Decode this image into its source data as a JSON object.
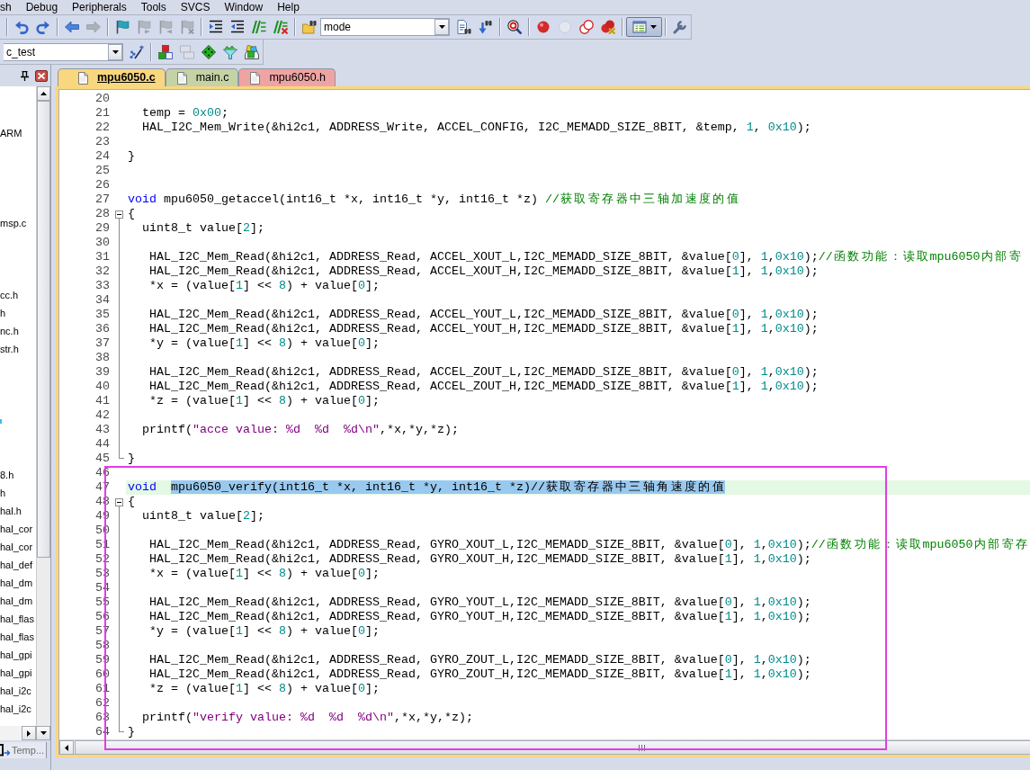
{
  "menu_bar": {
    "items": [
      "sh",
      "Debug",
      "Peripherals",
      "Tools",
      "SVCS",
      "Window",
      "Help"
    ]
  },
  "toolbars": [
    {
      "items": [
        {
          "kind": "separator"
        },
        {
          "kind": "button",
          "disabled": false,
          "on": false
        },
        {
          "kind": "button",
          "disabled": false,
          "on": false
        },
        {
          "kind": "separator"
        },
        {
          "kind": "button",
          "disabled": false,
          "on": false
        },
        {
          "kind": "button",
          "disabled": true,
          "on": false
        },
        {
          "kind": "separator"
        },
        {
          "kind": "button",
          "disabled": false,
          "on": false
        },
        {
          "kind": "button",
          "disabled": true,
          "on": false
        },
        {
          "kind": "button",
          "disabled": true,
          "on": false
        },
        {
          "kind": "button",
          "disabled": true,
          "on": false
        },
        {
          "kind": "separator"
        },
        {
          "kind": "button",
          "disabled": false,
          "on": false
        },
        {
          "kind": "button",
          "disabled": false,
          "on": false
        },
        {
          "kind": "button",
          "disabled": false,
          "on": false
        },
        {
          "kind": "button",
          "disabled": false,
          "on": false
        },
        {
          "kind": "separator"
        },
        {
          "kind": "button",
          "disabled": false,
          "on": false
        },
        {
          "kind": "combo",
          "value": "mode"
        },
        {
          "kind": "button",
          "disabled": false,
          "on": false
        },
        {
          "kind": "button",
          "disabled": false,
          "on": false
        },
        {
          "kind": "separator"
        },
        {
          "kind": "button",
          "disabled": false,
          "on": false
        },
        {
          "kind": "separator"
        },
        {
          "kind": "button",
          "disabled": false,
          "on": false
        },
        {
          "kind": "button",
          "disabled": true,
          "on": false
        },
        {
          "kind": "button",
          "disabled": false,
          "on": false
        },
        {
          "kind": "button",
          "disabled": false,
          "on": false
        },
        {
          "kind": "separator"
        },
        {
          "kind": "split_button",
          "disabled": false,
          "on": true
        },
        {
          "kind": "separator"
        },
        {
          "kind": "button",
          "disabled": false,
          "on": false
        }
      ]
    },
    {
      "items": [
        {
          "kind": "combo",
          "value": "c_test"
        },
        {
          "kind": "button",
          "disabled": false,
          "on": false
        },
        {
          "kind": "separator"
        },
        {
          "kind": "button",
          "disabled": false,
          "on": false
        },
        {
          "kind": "button",
          "disabled": true,
          "on": false
        },
        {
          "kind": "button",
          "disabled": false,
          "on": false
        },
        {
          "kind": "button",
          "disabled": false,
          "on": false
        },
        {
          "kind": "button",
          "disabled": false,
          "on": false
        }
      ]
    }
  ],
  "project_panel": {
    "items": [
      {
        "label": "ARM",
        "selected": false
      },
      {
        "label": "msp.c",
        "selected": false
      },
      {
        "label": "cc.h",
        "selected": false
      },
      {
        "label": "h",
        "selected": false
      },
      {
        "label": "nc.h",
        "selected": false
      },
      {
        "label": "str.h",
        "selected": false
      },
      {
        "label": "8.h",
        "selected": false
      },
      {
        "label": "h",
        "selected": false
      },
      {
        "label": "hal.h",
        "selected": false
      },
      {
        "label": "hal_cor",
        "selected": false
      },
      {
        "label": "hal_cor",
        "selected": false
      },
      {
        "label": "hal_def",
        "selected": false
      },
      {
        "label": "hal_dm",
        "selected": false
      },
      {
        "label": "hal_dm",
        "selected": false
      },
      {
        "label": "hal_flas",
        "selected": false
      },
      {
        "label": "hal_flas",
        "selected": false
      },
      {
        "label": "hal_gpi",
        "selected": false
      },
      {
        "label": "hal_gpi",
        "selected": false
      },
      {
        "label": "hal_i2c",
        "selected": false
      },
      {
        "label": "hal_i2c",
        "selected": false
      }
    ],
    "tabs": [
      {
        "label": "Temp...",
        "selected": false
      }
    ]
  },
  "editor": {
    "tabs": [
      {
        "label": "mpu6050.c",
        "selected": true,
        "color": "#f9d77f"
      },
      {
        "label": "main.c",
        "selected": false,
        "color": "#c5d2a5"
      },
      {
        "label": "mpu6050.h",
        "selected": false,
        "color": "#efa4a4"
      }
    ],
    "lines": [
      {
        "number": "20",
        "current": false
      },
      {
        "number": "21",
        "current": false,
        "segments": [
          {
            "kind": "code",
            "text": "  temp = 0x00;"
          }
        ]
      },
      {
        "number": "22",
        "current": false,
        "segments": [
          {
            "kind": "code",
            "text": "  HAL_I2C_Mem_Write(&hi2c1, ADDRESS_Write, ACCEL_CONFIG, I2C_MEMADD_SIZE_8BIT, &temp, 1, 0x10);"
          }
        ]
      },
      {
        "number": "23",
        "current": false
      },
      {
        "number": "24",
        "current": false,
        "segments": [
          {
            "kind": "code",
            "text": "}"
          }
        ]
      },
      {
        "number": "25",
        "current": false
      },
      {
        "number": "26",
        "current": false
      },
      {
        "number": "27",
        "current": false,
        "segments": [
          {
            "kind": "keyword",
            "text": "void"
          },
          {
            "kind": "code",
            "text": " mpu6050_getaccel(int16_t *x, int16_t *y, int16_t *z) "
          },
          {
            "kind": "comment",
            "text": "//获取寄存器中三轴加速度的值"
          }
        ]
      },
      {
        "number": "28",
        "current": false,
        "expanded": true,
        "segments": [
          {
            "kind": "code",
            "text": "{"
          }
        ],
        "children": [
          {
            "number": "29",
            "current": false,
            "segments": [
              {
                "kind": "code",
                "text": "  uint8_t value[2];"
              }
            ]
          },
          {
            "number": "30",
            "current": false
          },
          {
            "number": "31",
            "current": false,
            "segments": [
              {
                "kind": "code",
                "text": "   HAL_I2C_Mem_Read(&hi2c1, ADDRESS_Read, ACCEL_XOUT_L,I2C_MEMADD_SIZE_8BIT, &value[0], 1,0x10);"
              },
              {
                "kind": "comment",
                "text": "//函数功能：读取mpu6050内部寄"
              }
            ]
          },
          {
            "number": "32",
            "current": false,
            "segments": [
              {
                "kind": "code",
                "text": "   HAL_I2C_Mem_Read(&hi2c1, ADDRESS_Read, ACCEL_XOUT_H,I2C_MEMADD_SIZE_8BIT, &value[1], 1,0x10);"
              }
            ]
          },
          {
            "number": "33",
            "current": false,
            "segments": [
              {
                "kind": "code",
                "text": "   *x = (value[1] << 8) + value[0];"
              }
            ]
          },
          {
            "number": "34",
            "current": false
          },
          {
            "number": "35",
            "current": false,
            "segments": [
              {
                "kind": "code",
                "text": "   HAL_I2C_Mem_Read(&hi2c1, ADDRESS_Read, ACCEL_YOUT_L,I2C_MEMADD_SIZE_8BIT, &value[0], 1,0x10);"
              }
            ]
          },
          {
            "number": "36",
            "current": false,
            "segments": [
              {
                "kind": "code",
                "text": "   HAL_I2C_Mem_Read(&hi2c1, ADDRESS_Read, ACCEL_YOUT_H,I2C_MEMADD_SIZE_8BIT, &value[1], 1,0x10);"
              }
            ]
          },
          {
            "number": "37",
            "current": false,
            "segments": [
              {
                "kind": "code",
                "text": "   *y = (value[1] << 8) + value[0];"
              }
            ]
          },
          {
            "number": "38",
            "current": false
          },
          {
            "number": "39",
            "current": false,
            "segments": [
              {
                "kind": "code",
                "text": "   HAL_I2C_Mem_Read(&hi2c1, ADDRESS_Read, ACCEL_ZOUT_L,I2C_MEMADD_SIZE_8BIT, &value[0], 1,0x10);"
              }
            ]
          },
          {
            "number": "40",
            "current": false,
            "segments": [
              {
                "kind": "code",
                "text": "   HAL_I2C_Mem_Read(&hi2c1, ADDRESS_Read, ACCEL_ZOUT_H,I2C_MEMADD_SIZE_8BIT, &value[1], 1,0x10);"
              }
            ]
          },
          {
            "number": "41",
            "current": false,
            "segments": [
              {
                "kind": "code",
                "text": "   *z = (value[1] << 8) + value[0];"
              }
            ]
          },
          {
            "number": "42",
            "current": false
          },
          {
            "number": "43",
            "current": false,
            "segments": [
              {
                "kind": "code",
                "text": "  printf("
              },
              {
                "kind": "string",
                "text": "\"acce value: %d  %d  %d\\n\""
              },
              {
                "kind": "code",
                "text": ",*x,*y,*z);"
              }
            ]
          },
          {
            "number": "44",
            "current": false
          },
          {
            "number": "45",
            "current": false,
            "segments": [
              {
                "kind": "code",
                "text": "}"
              }
            ]
          }
        ]
      },
      {
        "number": "46",
        "current": false
      },
      {
        "number": "47",
        "current": true,
        "segments": [
          {
            "kind": "keyword",
            "text": "void  "
          },
          {
            "kind": "selection",
            "text": "mpu6050_verify(int16_t *x, int16_t *y, int16_t *z)//获取寄存器中三轴角速度的值"
          }
        ]
      },
      {
        "number": "48",
        "current": false,
        "expanded": true,
        "segments": [
          {
            "kind": "code",
            "text": "{"
          }
        ],
        "children": [
          {
            "number": "49",
            "current": false,
            "segments": [
              {
                "kind": "code",
                "text": "  uint8_t value[2];"
              }
            ]
          },
          {
            "number": "50",
            "current": false
          },
          {
            "number": "51",
            "current": false,
            "segments": [
              {
                "kind": "code",
                "text": "   HAL_I2C_Mem_Read(&hi2c1, ADDRESS_Read, GYRO_XOUT_L,I2C_MEMADD_SIZE_8BIT, &value[0], 1,0x10);"
              },
              {
                "kind": "comment",
                "text": "//函数功能：读取mpu6050内部寄存"
              }
            ]
          },
          {
            "number": "52",
            "current": false,
            "segments": [
              {
                "kind": "code",
                "text": "   HAL_I2C_Mem_Read(&hi2c1, ADDRESS_Read, GYRO_XOUT_H,I2C_MEMADD_SIZE_8BIT, &value[1], 1,0x10);"
              }
            ]
          },
          {
            "number": "53",
            "current": false,
            "segments": [
              {
                "kind": "code",
                "text": "   *x = (value[1] << 8) + value[0];"
              }
            ]
          },
          {
            "number": "54",
            "current": false
          },
          {
            "number": "55",
            "current": false,
            "segments": [
              {
                "kind": "code",
                "text": "   HAL_I2C_Mem_Read(&hi2c1, ADDRESS_Read, GYRO_YOUT_L,I2C_MEMADD_SIZE_8BIT, &value[0], 1,0x10);"
              }
            ]
          },
          {
            "number": "56",
            "current": false,
            "segments": [
              {
                "kind": "code",
                "text": "   HAL_I2C_Mem_Read(&hi2c1, ADDRESS_Read, GYRO_YOUT_H,I2C_MEMADD_SIZE_8BIT, &value[1], 1,0x10);"
              }
            ]
          },
          {
            "number": "57",
            "current": false,
            "segments": [
              {
                "kind": "code",
                "text": "   *y = (value[1] << 8) + value[0];"
              }
            ]
          },
          {
            "number": "58",
            "current": false
          },
          {
            "number": "59",
            "current": false,
            "segments": [
              {
                "kind": "code",
                "text": "   HAL_I2C_Mem_Read(&hi2c1, ADDRESS_Read, GYRO_ZOUT_L,I2C_MEMADD_SIZE_8BIT, &value[0], 1,0x10);"
              }
            ]
          },
          {
            "number": "60",
            "current": false,
            "segments": [
              {
                "kind": "code",
                "text": "   HAL_I2C_Mem_Read(&hi2c1, ADDRESS_Read, GYRO_ZOUT_H,I2C_MEMADD_SIZE_8BIT, &value[1], 1,0x10);"
              }
            ]
          },
          {
            "number": "61",
            "current": false,
            "segments": [
              {
                "kind": "code",
                "text": "   *z = (value[1] << 8) + value[0];"
              }
            ]
          },
          {
            "number": "62",
            "current": false
          },
          {
            "number": "63",
            "current": false,
            "segments": [
              {
                "kind": "code",
                "text": "  printf("
              },
              {
                "kind": "string",
                "text": "\"verify value: %d  %d  %d\\n\""
              },
              {
                "kind": "code",
                "text": ",*x,*y,*z);"
              }
            ]
          },
          {
            "number": "64",
            "current": false,
            "segments": [
              {
                "kind": "code",
                "text": "}"
              }
            ]
          }
        ]
      }
    ]
  }
}
